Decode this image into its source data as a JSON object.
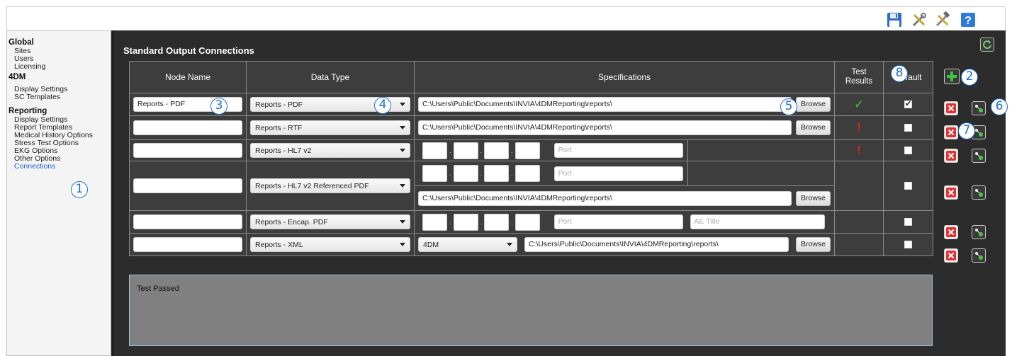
{
  "toolbar": {
    "icons": [
      "save-icon",
      "tools-icon",
      "wrench-hammer-icon",
      "help-icon"
    ]
  },
  "sidebar": {
    "sections": [
      {
        "title": "Global",
        "items": [
          "Sites",
          "Users",
          "Licensing"
        ]
      },
      {
        "title": "4DM",
        "items": [
          "Display Settings",
          "SC Templates"
        ]
      },
      {
        "title": "Reporting",
        "items": [
          "Display Settings",
          "Report Templates",
          "Medical History Options",
          "Stress Test Options",
          "EKG Options",
          "Other Options",
          "Connections"
        ]
      }
    ],
    "active_item": "Connections"
  },
  "panel": {
    "title": "Standard Output Connections"
  },
  "table": {
    "headers": {
      "node_name": "Node Name",
      "data_type": "Data Type",
      "specifications": "Specifications",
      "test_results": "Test\nResults",
      "default": "Default"
    },
    "browse_label": "Browse",
    "port_placeholder": "Port",
    "ae_title_placeholder": "AE Title",
    "rows": [
      {
        "node_name": "Reports - PDF",
        "data_type": "Reports - PDF",
        "path": "C:\\Users\\Public\\Documents\\INVIA\\4DMReporting\\reports\\",
        "test_result": "✓",
        "default": true
      },
      {
        "node_name": "",
        "data_type": "Reports - RTF",
        "path": "C:\\Users\\Public\\Documents\\INVIA\\4DMReporting\\reports\\",
        "test_result": "!",
        "default": false
      },
      {
        "node_name": "",
        "data_type": "Reports - HL7 v2",
        "test_result": "!",
        "default": false
      },
      {
        "node_name": "",
        "data_type": "Reports - HL7 v2 Referenced PDF",
        "path": "C:\\Users\\Public\\Documents\\INVIA\\4DMReporting\\reports\\",
        "test_result": "",
        "default": false
      },
      {
        "node_name": "",
        "data_type": "Reports - Encap. PDF",
        "test_result": "",
        "default": false
      },
      {
        "node_name": "",
        "data_type": "Reports - XML",
        "format": "4DM",
        "path": "C:\\Users\\Public\\Documents\\INVIA\\4DMReporting\\reports\\",
        "test_result": "",
        "default": false
      }
    ]
  },
  "status_text": "Test Passed",
  "callouts": [
    "1",
    "2",
    "3",
    "4",
    "5",
    "6",
    "7",
    "8"
  ],
  "colors": {
    "pass": "#33cc33",
    "fail": "#e02020",
    "active_link": "#1b5fd6",
    "panel_bg": "#2c2c2c",
    "callout": "#1b6fd1"
  }
}
